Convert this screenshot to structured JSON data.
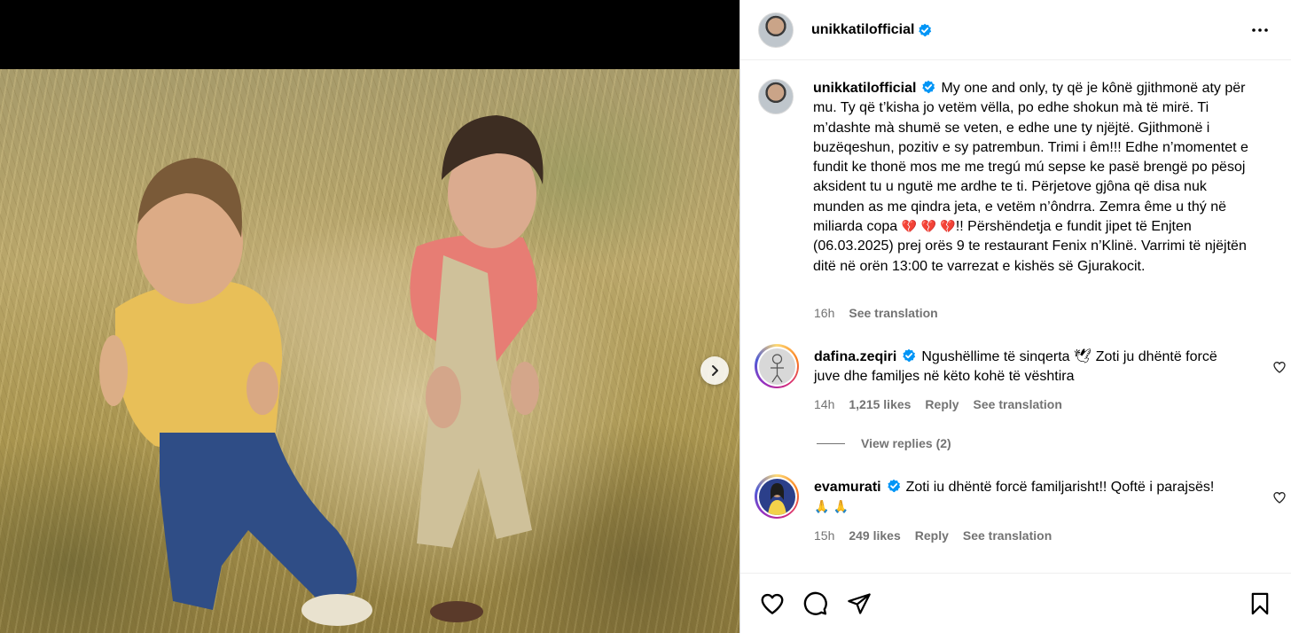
{
  "post": {
    "username": "unikkatilofficial",
    "verified": true
  },
  "caption": {
    "username": "unikkatilofficial",
    "text_part1": "My one and only, ty që je kônë gjithmonë aty për mu. Ty që t’kisha jo vetëm vëlla, po edhe shokun mà të mirë. Ti m’dashte mà shumë se veten, e edhe une ty njëjtë. Gjithmonë i buzëqeshun, pozitiv e sy patrembun. Trimi i êm!!! Edhe n’momentet e fundit ke thonë mos me me tregú mú sepse ke pasë brengë po pësoj aksident tu u ngutë me ardhe te ti. Përjetove gjôna që disa nuk munden as me qindra jeta, e vetëm n’ôndrra. Zemra ême u thý në miliarda copa",
    "emoji_hearts": "💔 💔 💔",
    "text_part2": "!! Përshëndetja e fundit jipet të Enjten (06.03.2025) prej orës 9 te restaurant Fenix n’Klinë. Varrimi të njëjtën ditë në orën 13:00 te varrezat e kishës së Gjurakocit.",
    "time": "16h",
    "see_translation": "See translation"
  },
  "comments": [
    {
      "username": "dafina.zeqiri",
      "verified": true,
      "text": "Ngushëllime të sinqerta 🕊 Zoti ju dhëntë forcë juve dhe familjes në këto kohë të vështira",
      "time": "14h",
      "likes": "1,215 likes",
      "reply": "Reply",
      "see_translation": "See translation",
      "view_replies": "View replies (2)"
    },
    {
      "username": "evamurati",
      "verified": true,
      "text": "Zoti iu dhëntë forcë familjarisht!! Qoftë i parajsës!",
      "emoji": "🙏 🙏",
      "time": "15h",
      "likes": "249 likes",
      "reply": "Reply",
      "see_translation": "See translation"
    }
  ],
  "icons": {
    "more": "more-horizontal-icon",
    "next": "chevron-right-icon",
    "like": "heart-outline-icon",
    "comment": "comment-bubble-icon",
    "share": "paper-plane-icon",
    "save": "bookmark-icon",
    "verified": "verified-badge-icon"
  },
  "colors": {
    "verified": "#0095f6",
    "secondary_text": "#737373",
    "border": "#dbdbdb"
  }
}
